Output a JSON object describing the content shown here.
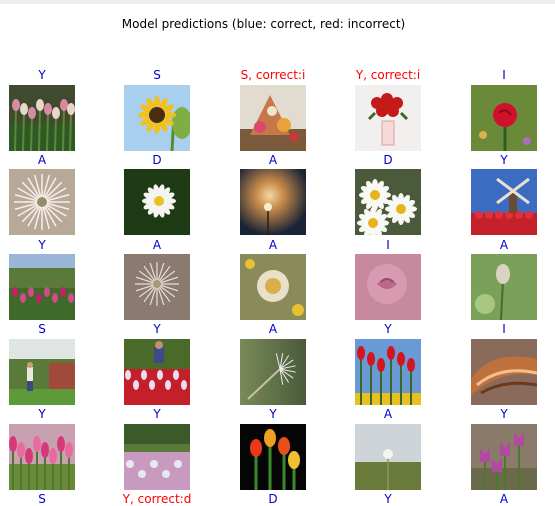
{
  "title": "Model predictions (blue: correct, red: incorrect)",
  "colors": {
    "correct": "#0000cc",
    "incorrect": "#ff0000"
  },
  "chart_data": {
    "type": "image-grid",
    "rows": 5,
    "cols": 5,
    "cells": [
      {
        "label": "Y",
        "correct": true,
        "subject": "tulips"
      },
      {
        "label": "S",
        "correct": true,
        "subject": "sunflower"
      },
      {
        "label": "S, correct:i",
        "correct": false,
        "subject": "flower-float"
      },
      {
        "label": "Y, correct:i",
        "correct": false,
        "subject": "rose-bouquet"
      },
      {
        "label": "I",
        "correct": true,
        "subject": "red-rose"
      },
      {
        "label": "A",
        "correct": true,
        "subject": "dandelion-seedhead"
      },
      {
        "label": "D",
        "correct": true,
        "subject": "daisy"
      },
      {
        "label": "A",
        "correct": true,
        "subject": "sunset-dandelion"
      },
      {
        "label": "D",
        "correct": true,
        "subject": "daisies-bee"
      },
      {
        "label": "Y",
        "correct": true,
        "subject": "windmill-tulips"
      },
      {
        "label": "Y",
        "correct": true,
        "subject": "tulip-garden"
      },
      {
        "label": "A",
        "correct": true,
        "subject": "dandelion-clock"
      },
      {
        "label": "A",
        "correct": true,
        "subject": "dandelion-flower"
      },
      {
        "label": "I",
        "correct": true,
        "subject": "pink-rose"
      },
      {
        "label": "A",
        "correct": true,
        "subject": "dandelion-closed"
      },
      {
        "label": "S",
        "correct": true,
        "subject": "garden-person"
      },
      {
        "label": "Y",
        "correct": true,
        "subject": "tulip-field-person"
      },
      {
        "label": "A",
        "correct": true,
        "subject": "dandelion-seed"
      },
      {
        "label": "Y",
        "correct": true,
        "subject": "red-tulips-sky"
      },
      {
        "label": "I",
        "correct": true,
        "subject": "fungus"
      },
      {
        "label": "Y",
        "correct": true,
        "subject": "pink-tulips"
      },
      {
        "label": "Y",
        "correct": true,
        "subject": "tulip-park"
      },
      {
        "label": "Y",
        "correct": true,
        "subject": "tulips-black"
      },
      {
        "label": "A",
        "correct": true,
        "subject": "dandelion-meadow"
      },
      {
        "label": "Y",
        "correct": true,
        "subject": "purple-tulips"
      }
    ],
    "bottom_labels": [
      {
        "label": "S",
        "correct": true
      },
      {
        "label": "Y, correct:d",
        "correct": false
      },
      {
        "label": "D",
        "correct": true
      },
      {
        "label": "Y",
        "correct": true
      },
      {
        "label": "A",
        "correct": true
      }
    ]
  }
}
